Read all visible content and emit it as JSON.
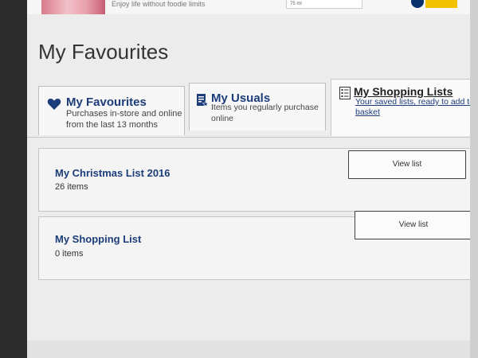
{
  "banner": {
    "tagline": "Enjoy life without foodie limits",
    "pack_text": "75 ml"
  },
  "page": {
    "title": "My Favourites"
  },
  "tabs": [
    {
      "title": "My Favourites",
      "description": "Purchases in-store and online from the last 13 months",
      "icon": "heart-icon"
    },
    {
      "title": "My Usuals",
      "description": "Items you regularly purchase online",
      "icon": "list-star-icon"
    },
    {
      "title": "My Shopping Lists",
      "description": "Your saved lists, ready to add to basket",
      "icon": "checklist-icon"
    }
  ],
  "lists": [
    {
      "name": "My Christmas List 2016",
      "count": "26 items",
      "button": "View list"
    },
    {
      "name": "My Shopping List",
      "count": "0 items",
      "button": "View list"
    }
  ],
  "colors": {
    "brand_blue": "#1c3d7a",
    "page_bg": "#ececec"
  }
}
